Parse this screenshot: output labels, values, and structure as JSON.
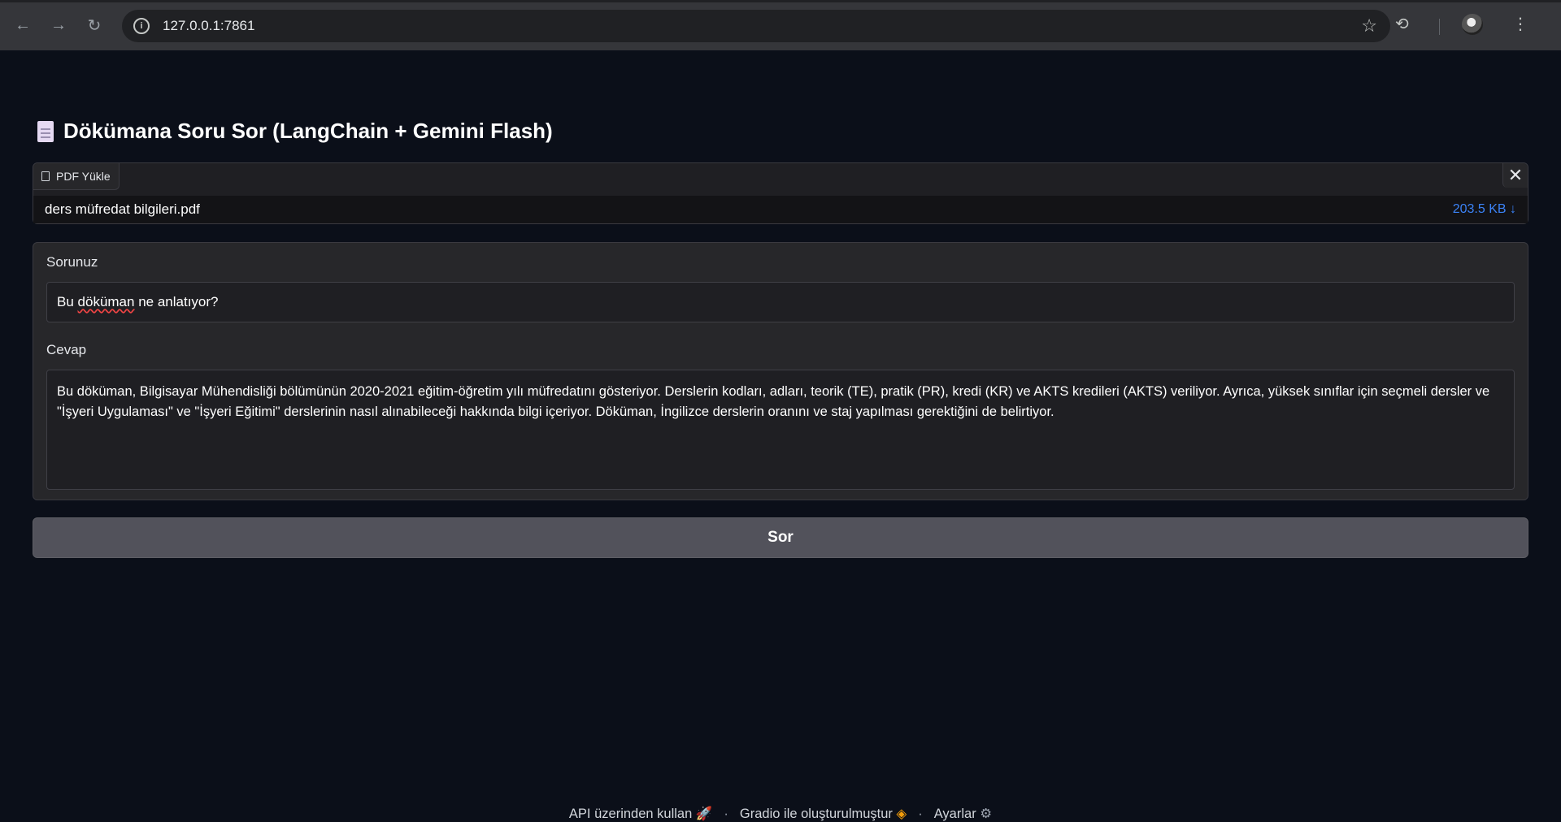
{
  "browser": {
    "url": "127.0.0.1:7861",
    "icons": {
      "back": "arrow-left-icon",
      "forward": "arrow-right-icon",
      "reload": "reload-icon",
      "info": "info-icon",
      "bookmark": "star-icon",
      "history": "history-icon",
      "menu": "kebab-menu-icon"
    }
  },
  "app": {
    "title": "Dökümana Soru Sor (LangChain + Gemini Flash)",
    "file_upload": {
      "label": "PDF Yükle",
      "file_name": "ders müfredat bilgileri.pdf",
      "file_size": "203.5 KB ↓"
    },
    "question": {
      "label": "Sorunuz",
      "value_before": "Bu ",
      "value_misspelled": "döküman",
      "value_after": " ne anlatıyor?"
    },
    "answer": {
      "label": "Cevap",
      "value": "Bu döküman, Bilgisayar Mühendisliği bölümünün 2020-2021 eğitim-öğretim yılı müfredatını gösteriyor.  Derslerin kodları, adları, teorik (TE), pratik (PR), kredi (KR) ve AKTS kredileri (AKTS)  veriliyor.  Ayrıca,  yüksek sınıflar için seçmeli dersler ve \"İşyeri Uygulaması\" ve \"İşyeri Eğitimi\" derslerinin nasıl alınabileceği hakkında bilgi içeriyor.  Döküman,  İngilizce derslerin oranını ve staj yapılması gerektiğini de belirtiyor."
    },
    "submit_label": "Sor"
  },
  "footer": {
    "api": "API üzerinden kullan",
    "built_with": "Gradio ile oluşturulmuştur",
    "settings": "Ayarlar",
    "separator": "·"
  },
  "colors": {
    "background": "#0b0f19",
    "accent_link": "#3b82f6",
    "button": "#52525b"
  }
}
